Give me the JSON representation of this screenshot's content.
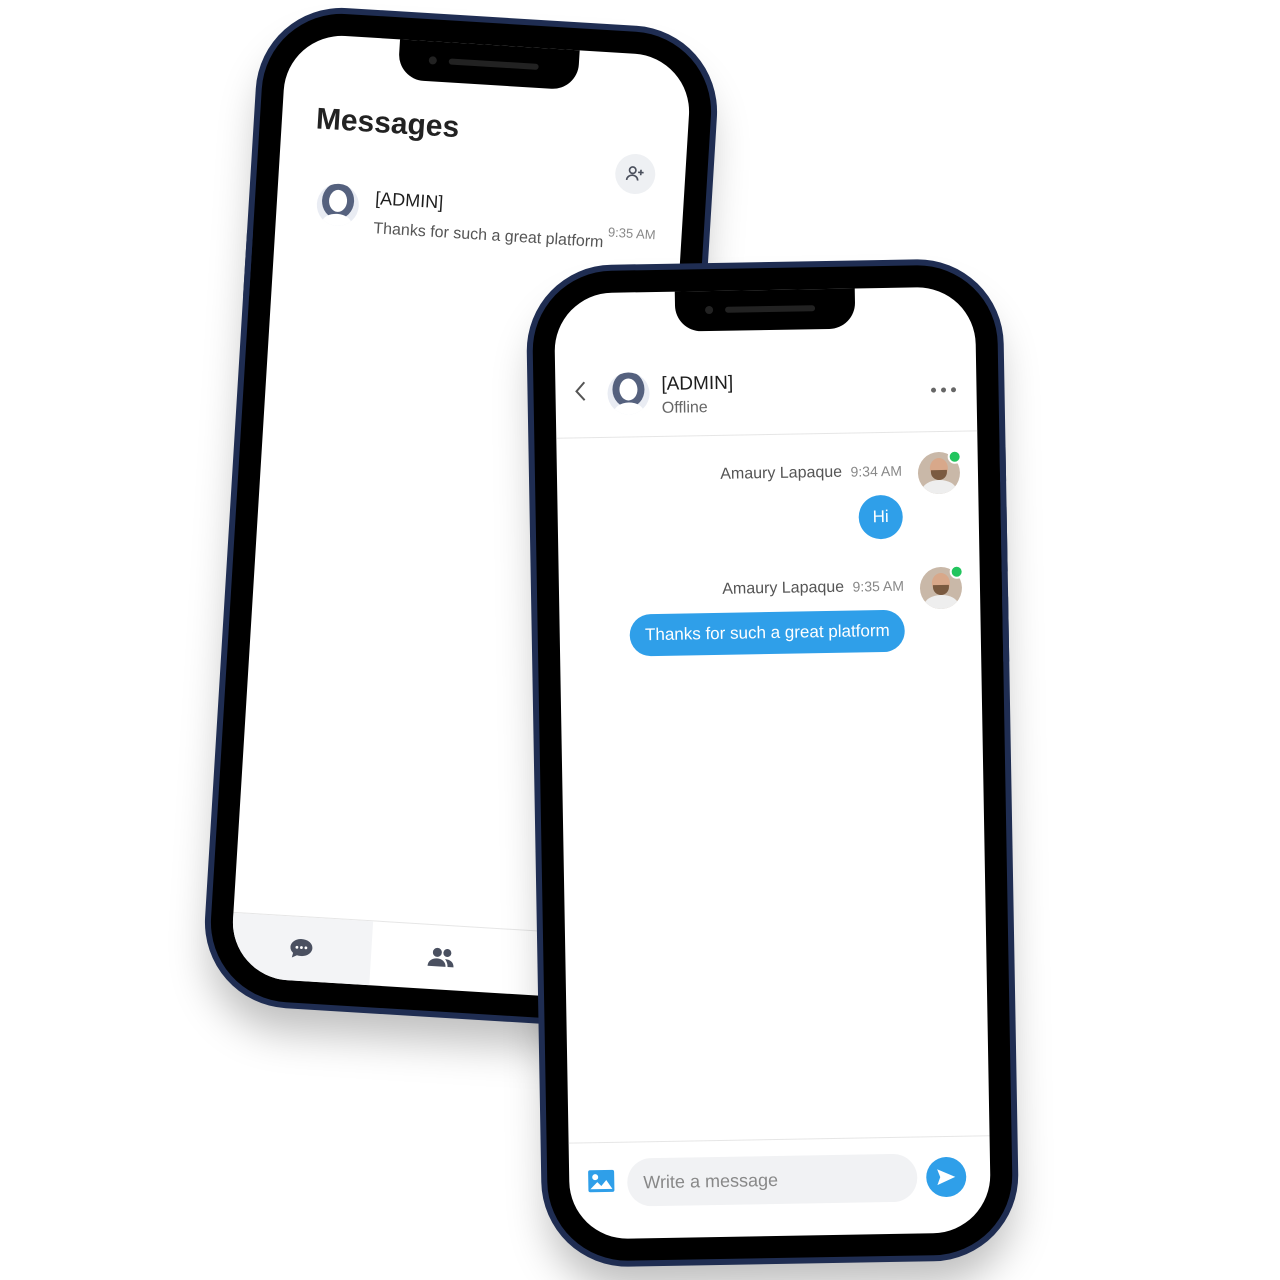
{
  "list_screen": {
    "title": "Messages",
    "conversations": [
      {
        "name": "[ADMIN]",
        "time": "9:35 AM",
        "preview": "Thanks for such a great platform"
      }
    ],
    "tabs": [
      "messages",
      "contacts"
    ]
  },
  "chat_screen": {
    "contact_name": "[ADMIN]",
    "contact_status": "Offline",
    "messages": [
      {
        "sender": "Amaury Lapaque",
        "time": "9:34 AM",
        "text": "Hi"
      },
      {
        "sender": "Amaury Lapaque",
        "time": "9:35 AM",
        "text": "Thanks for such a great platform"
      }
    ],
    "composer_placeholder": "Write a message"
  },
  "colors": {
    "accent": "#2f9fe9",
    "frame": "#1f2d52",
    "online": "#22c55e"
  }
}
